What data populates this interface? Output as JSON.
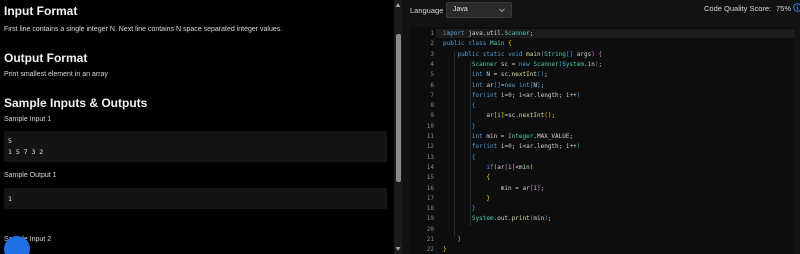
{
  "problem": {
    "input_format_title": "Input Format",
    "input_format_text": "First line contains a single integer N. Next line contains N space separated integer values.",
    "output_format_title": "Output Format",
    "output_format_text": "Print smallest element in an array",
    "samples_title": "Sample Inputs & Outputs",
    "sample_input_1_label": "Sample Input 1",
    "sample_input_1_lines": [
      "5",
      "1 5 7 3 2"
    ],
    "sample_output_1_label": "Sample Output 1",
    "sample_output_1_lines": [
      "1"
    ],
    "sample_input_2_label": "Sample Input 2"
  },
  "toolbar": {
    "language_label": "Language",
    "language_value": "Java",
    "code_quality_label": "Code Quality Score:",
    "code_quality_value": "75%"
  },
  "editor": {
    "line_numbers": [
      "1",
      "2",
      "3",
      "4",
      "5",
      "6",
      "7",
      "8",
      "9",
      "10",
      "11",
      "12",
      "13",
      "14",
      "15",
      "16",
      "17",
      "18",
      "19",
      "20",
      "21",
      "22"
    ],
    "lines": [
      "import java.util.Scanner;",
      "public class Main {",
      "    public static void main(String[] args) {",
      "        Scanner sc = new Scanner(System.in);",
      "        int N = sc.nextInt();",
      "        int ar[]=new int[N];",
      "        for(int i=0; i<ar.length; i++)",
      "        {",
      "            ar[i]=sc.nextInt();",
      "        }",
      "        int min = Integer.MAX_VALUE;",
      "        for(int i=0; i<ar.length; i++)",
      "        {",
      "            if(ar[i]<min)",
      "            {",
      "                min = ar[i];",
      "            }",
      "        }",
      "        System.out.print(min);",
      "",
      "    }",
      "}"
    ]
  },
  "colors": {
    "accent": "#1f6fe5",
    "keyword": "#569cd6",
    "type": "#4ec9b0",
    "function": "#dcdcaa",
    "bracket_1": "#ffd700",
    "bracket_2": "#da70d6",
    "bracket_3": "#179fff"
  },
  "icons": {
    "dropdown": "chevron-down-icon",
    "info": "info-icon",
    "fab": "chat-icon"
  }
}
